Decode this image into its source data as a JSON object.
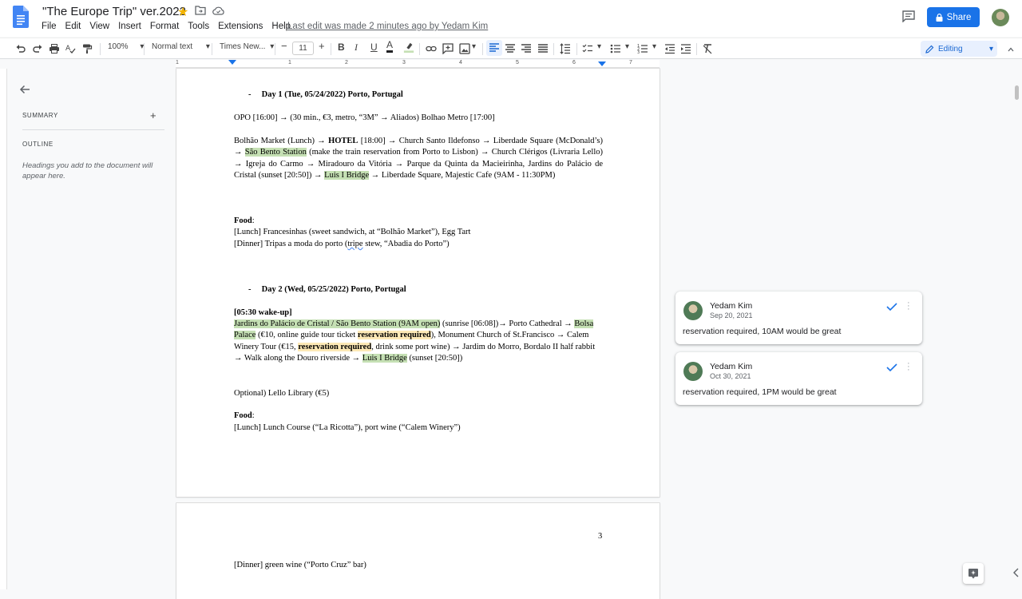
{
  "header": {
    "title": "\"The Europe Trip\" ver.2022",
    "menu": [
      "File",
      "Edit",
      "View",
      "Insert",
      "Format",
      "Tools",
      "Extensions",
      "Help"
    ],
    "last_edit": "Last edit was made 2 minutes ago by Yedam Kim",
    "share_label": "Share"
  },
  "toolbar": {
    "zoom": "100%",
    "style": "Normal text",
    "font": "Times New...",
    "font_size": "11",
    "mode": "Editing",
    "text_color": "#202124",
    "highlight_color": "#c5e0b4"
  },
  "ruler": [
    "1",
    "1",
    "2",
    "3",
    "4",
    "5",
    "6",
    "7"
  ],
  "outline": {
    "summary_label": "SUMMARY",
    "outline_label": "OUTLINE",
    "hint": "Headings you add to the document will appear here."
  },
  "doc": {
    "day1_heading": "Day 1 (Tue, 05/24/2022) Porto, Portugal",
    "day1_transit": "OPO [16:00] → (30 min., €3, metro, “3M” → Aliados) Bolhao Metro [17:00]",
    "day1_route": {
      "p1": "Bolhão Market (Lunch) → ",
      "hotel": "HOTEL",
      "p2": " [18:00] → Church Santo Ildefonso → Liberdade Square (McDonald’s) → ",
      "hl1": "São Bento Station",
      "p3": " (make the train reservation from Porto to Lisbon) → Church Clérigos (Livraria Lello) → Igreja do Carmo → Miradouro da Vitória → Parque da Quinta da Macieirinha, Jardins do Palácio de Cristal (sunset [20:50]) → ",
      "hl2": "Luis I Bridge",
      "p4": " → Liberdade Square, Majestic Cafe (9AM - 11:30PM)"
    },
    "food_label": "Food",
    "day1_lunch": "[Lunch] Francesinhas (sweet sandwich, at “Bolhão Market”), Egg Tart",
    "day1_dinner_a": "[Dinner] Tripas a moda do porto (",
    "day1_dinner_squig": "tripe",
    "day1_dinner_b": " stew, “Abadia do Porto”)",
    "day2_heading": "Day 2 (Wed, 05/25/2022) Porto, Portugal",
    "day2_wake": "[05:30 wake-up]",
    "day2_route": {
      "hl1": "Jardins do Palácio de Cristal / São Bento Station (9AM open)",
      "p1": " (sunrise [06:08])→ Porto Cathedral → ",
      "hl2": "Bolsa Palace",
      "p2": " (€10, online guide tour ticket ",
      "res1": "reservation required",
      "p3": "), Monument Church of St.Francisco → Calem Winery Tour (€15, ",
      "res2": "reservation required",
      "p4": ", drink some port wine) → Jardim do Morro, Bordalo II half rabbit → Walk along the Douro riverside → ",
      "hl3": "Luis I Bridge",
      "p5": " (sunset [20:50])"
    },
    "optional": "Optional) Lello Library (€5)",
    "day2_lunch": "[Lunch] Lunch Course (“La Ricotta”), port wine (“Calem Winery”)",
    "page_number": "3",
    "day2_dinner": "[Dinner] green wine (“Porto Cruz” bar)"
  },
  "comments": [
    {
      "author": "Yedam Kim",
      "date": "Sep 20, 2021",
      "text": "reservation required, 10AM would be great"
    },
    {
      "author": "Yedam Kim",
      "date": "Oct 30, 2021",
      "text": "reservation required, 1PM would be great"
    }
  ],
  "colors": {
    "accent": "#1a73e8",
    "highlight_green": "#c5e0b4",
    "highlight_yellow": "#fde9b6"
  }
}
